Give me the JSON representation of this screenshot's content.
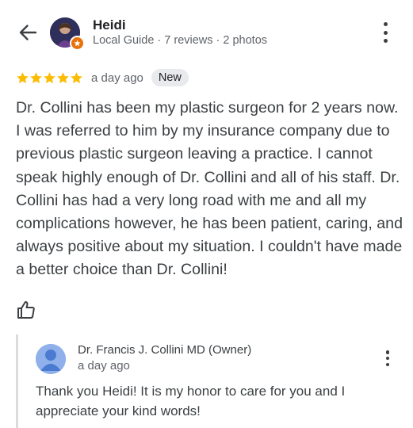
{
  "reviewer": {
    "name": "Heidi",
    "meta": "Local Guide · 7 reviews · 2 photos"
  },
  "review": {
    "rating": 5,
    "max_rating": 5,
    "star_color": "#fbbc04",
    "time": "a day ago",
    "badge": "New",
    "text": "Dr. Collini has been my plastic surgeon for 2 years now. I was referred to him by my insurance company due to previous plastic surgeon leaving a practice. I cannot speak highly enough of Dr. Collini and all of his staff. Dr. Collini has had a very long road with me and all my complications however, he has been patient, caring, and always positive about my situation. I couldn't have made a better choice than Dr. Collini!"
  },
  "owner_reply": {
    "name": "Dr. Francis J. Collini MD (Owner)",
    "time": "a day ago",
    "text": "Thank you Heidi! It is my honor to care for you and I appreciate your kind words!"
  },
  "icons": {
    "back": "arrow-back-icon",
    "more": "more-vert-icon",
    "like": "thumb-up-icon",
    "local_guide": "local-guide-badge-icon"
  }
}
